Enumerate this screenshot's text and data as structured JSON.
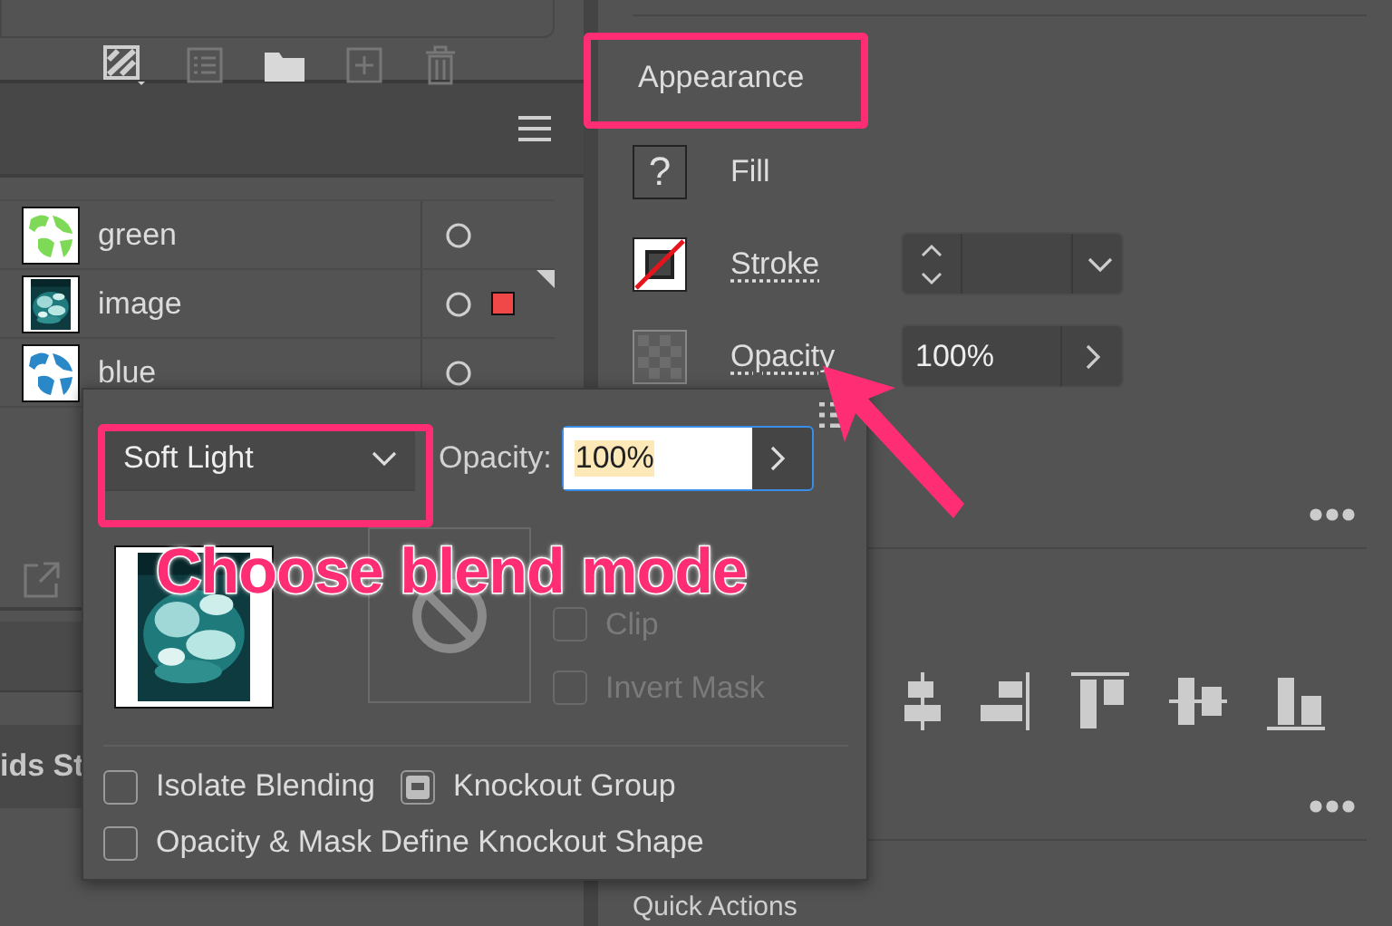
{
  "layers": [
    {
      "name": "green",
      "kind": "globe",
      "color": "#7ed957",
      "has_selection": false
    },
    {
      "name": "image",
      "kind": "picture",
      "has_selection": true
    },
    {
      "name": "blue",
      "kind": "globe",
      "color": "#2b88c8",
      "has_selection": false
    }
  ],
  "left_partial_label": "ids St",
  "appearance": {
    "title": "Appearance",
    "rows": [
      {
        "kind": "fill",
        "label": "Fill",
        "swatch_text": "?"
      },
      {
        "kind": "stroke",
        "label": "Stroke"
      },
      {
        "kind": "opacity",
        "label": "Opacity",
        "value": "100%"
      }
    ]
  },
  "quick_actions_title": "Quick Actions",
  "transparency_popup": {
    "blend_mode": "Soft Light",
    "opacity_label": "Opacity:",
    "opacity_value": "100%",
    "mask_options": [
      {
        "label": "Clip",
        "checked": false,
        "disabled": true
      },
      {
        "label": "Invert Mask",
        "checked": false,
        "disabled": true
      }
    ],
    "options": [
      {
        "label": "Isolate Blending",
        "checked": false,
        "indeterminate": false
      },
      {
        "label": "Knockout Group",
        "indeterminate": true
      },
      {
        "label": "Opacity & Mask Define Knockout Shape",
        "checked": false,
        "indeterminate": false
      }
    ]
  },
  "callout": "Choose blend mode"
}
